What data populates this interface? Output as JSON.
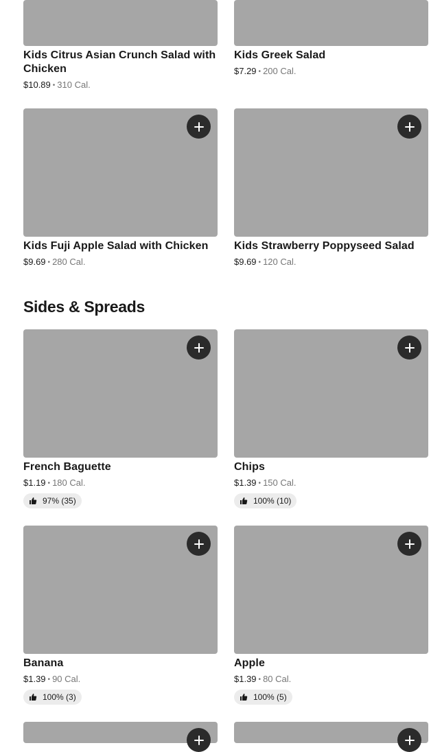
{
  "items": {
    "kids_citrus": {
      "name": "Kids Citrus Asian Crunch Salad with Chicken",
      "price": "$10.89",
      "cal": "310 Cal."
    },
    "kids_greek": {
      "name": "Kids Greek Salad",
      "price": "$7.29",
      "cal": "200 Cal."
    },
    "kids_fuji": {
      "name": "Kids Fuji Apple Salad with Chicken",
      "price": "$9.69",
      "cal": "280 Cal."
    },
    "kids_strawberry": {
      "name": "Kids Strawberry Poppyseed Salad",
      "price": "$9.69",
      "cal": "120 Cal."
    },
    "baguette": {
      "name": "French Baguette",
      "price": "$1.19",
      "cal": "180 Cal.",
      "rating": "97% (35)"
    },
    "chips": {
      "name": "Chips",
      "price": "$1.39",
      "cal": "150 Cal.",
      "rating": "100% (10)"
    },
    "banana": {
      "name": "Banana",
      "price": "$1.39",
      "cal": "90 Cal.",
      "rating": "100% (3)"
    },
    "apple": {
      "name": "Apple",
      "price": "$1.39",
      "cal": "80 Cal.",
      "rating": "100% (5)"
    }
  },
  "sections": {
    "sides_title": "Sides & Spreads"
  },
  "separator": "•",
  "icons": {
    "add": "plus-icon",
    "rating": "thumbs-up-icon"
  },
  "colors": {
    "placeholder": "#a6a6a6",
    "button": "#2b2b2b",
    "pill": "#ececec",
    "muted": "#767676"
  }
}
